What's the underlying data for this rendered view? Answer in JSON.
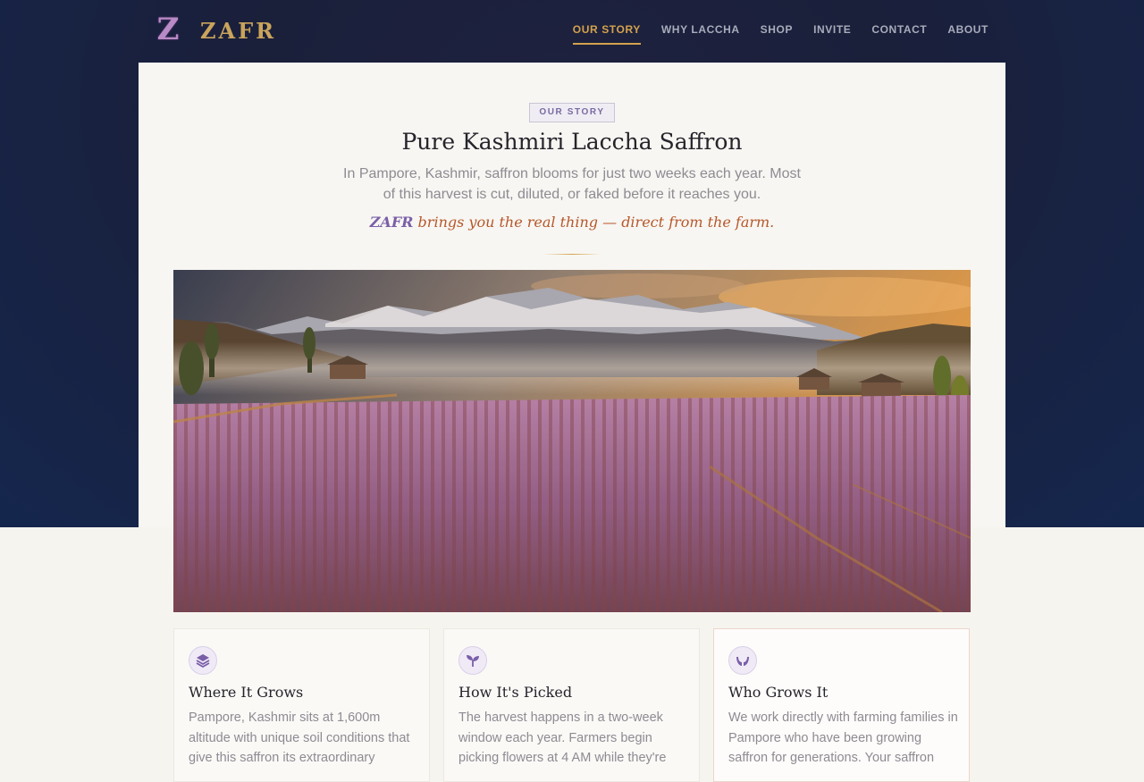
{
  "brand": {
    "name": "ZAFR",
    "logo_glyph": "Z",
    "accent_color": "#d4a24c"
  },
  "nav": {
    "items": [
      {
        "label": "OUR STORY",
        "active": true
      },
      {
        "label": "WHY LACCHA"
      },
      {
        "label": "SHOP"
      },
      {
        "label": "INVITE"
      },
      {
        "label": "CONTACT"
      },
      {
        "label": "ABOUT"
      }
    ]
  },
  "story": {
    "badge": "OUR STORY",
    "title": "Pure Kashmiri Laccha Saffron",
    "subtitle": "In Pampore, Kashmir, saffron blooms for just two weeks each year. Most of this harvest is cut, diluted, or faked before it reaches you.",
    "tagline_brand": "ZAFR",
    "tagline_rest": " brings you the real thing — direct from the farm."
  },
  "features": [
    {
      "icon": "layers-icon",
      "title": "Where It Grows",
      "body": "Pampore, Kashmir sits at 1,600m altitude with unique soil conditions that give this saffron its extraordinary"
    },
    {
      "icon": "sprout-icon",
      "title": "How It's Picked",
      "body": "The harvest happens in a two-week window each year. Farmers begin picking flowers at 4 AM while they're"
    },
    {
      "icon": "hands-icon",
      "title": "Who Grows It",
      "body": "We work directly with farming families in Pampore who have been growing saffron for generations. Your saffron"
    }
  ]
}
